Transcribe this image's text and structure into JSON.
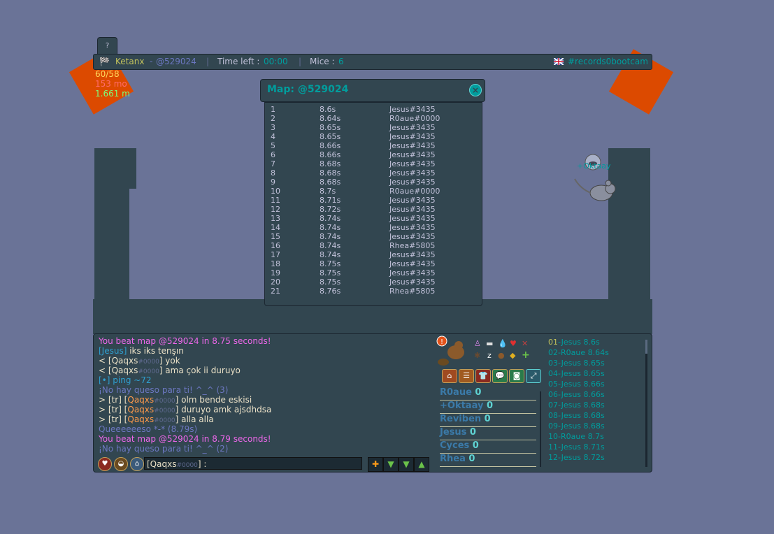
{
  "help_tab": "?",
  "top_bar": {
    "player": "Ketanx",
    "map_code": "@529024",
    "time_left_label": "Time left :",
    "time_left_value": "00:00",
    "mice_label": "Mice :",
    "mice_value": "6",
    "room": "#records0bootcam"
  },
  "stats": {
    "line1": "60/58",
    "line2": "153 mo",
    "line3": "1.661 m"
  },
  "mouse_label": "+Oktaay",
  "records_modal": {
    "title": "Map: @529024",
    "close": "×",
    "rows": [
      {
        "rank": "1",
        "time": "8.6s",
        "player": "Jesus#3435"
      },
      {
        "rank": "2",
        "time": "8.64s",
        "player": "R0aue#0000"
      },
      {
        "rank": "3",
        "time": "8.65s",
        "player": "Jesus#3435"
      },
      {
        "rank": "4",
        "time": "8.65s",
        "player": "Jesus#3435"
      },
      {
        "rank": "5",
        "time": "8.66s",
        "player": "Jesus#3435"
      },
      {
        "rank": "6",
        "time": "8.66s",
        "player": "Jesus#3435"
      },
      {
        "rank": "7",
        "time": "8.68s",
        "player": "Jesus#3435"
      },
      {
        "rank": "8",
        "time": "8.68s",
        "player": "Jesus#3435"
      },
      {
        "rank": "9",
        "time": "8.68s",
        "player": "Jesus#3435"
      },
      {
        "rank": "10",
        "time": "8.7s",
        "player": "R0aue#0000"
      },
      {
        "rank": "11",
        "time": "8.71s",
        "player": "Jesus#3435"
      },
      {
        "rank": "12",
        "time": "8.72s",
        "player": "Jesus#3435"
      },
      {
        "rank": "13",
        "time": "8.74s",
        "player": "Jesus#3435"
      },
      {
        "rank": "14",
        "time": "8.74s",
        "player": "Jesus#3435"
      },
      {
        "rank": "15",
        "time": "8.74s",
        "player": "Jesus#3435"
      },
      {
        "rank": "16",
        "time": "8.74s",
        "player": "Rhea#5805"
      },
      {
        "rank": "17",
        "time": "8.74s",
        "player": "Jesus#3435"
      },
      {
        "rank": "18",
        "time": "8.75s",
        "player": "Jesus#3435"
      },
      {
        "rank": "19",
        "time": "8.75s",
        "player": "Jesus#3435"
      },
      {
        "rank": "20",
        "time": "8.75s",
        "player": "Jesus#3435"
      },
      {
        "rank": "21",
        "time": "8.76s",
        "player": "Rhea#5805"
      }
    ]
  },
  "chat": [
    {
      "parts": [
        {
          "t": "You beat map @529024 in 8.75 seconds!",
          "c": "pink"
        }
      ]
    },
    {
      "parts": [
        {
          "t": "[Jesus]",
          "c": "teal"
        },
        {
          "t": " iks iks tenşın",
          "c": "cream"
        }
      ]
    },
    {
      "parts": [
        {
          "t": "< [",
          "c": "cream"
        },
        {
          "t": "Qaqxs",
          "c": "cream"
        },
        {
          "t": "#0000",
          "c": "small"
        },
        {
          "t": "] yok",
          "c": "cream"
        }
      ]
    },
    {
      "parts": [
        {
          "t": "< [",
          "c": "cream"
        },
        {
          "t": "Qaqxs",
          "c": "cream"
        },
        {
          "t": "#0000",
          "c": "small"
        },
        {
          "t": "] ama çok ii duruyo",
          "c": "cream"
        }
      ]
    },
    {
      "parts": [
        {
          "t": "[•] ping ~72",
          "c": "teal"
        }
      ]
    },
    {
      "parts": [
        {
          "t": "¡No hay queso para ti! ^_^ (3)",
          "c": "mid"
        }
      ]
    },
    {
      "parts": [
        {
          "t": "> [tr] [",
          "c": "cream"
        },
        {
          "t": "Qaqxs",
          "c": "orangename"
        },
        {
          "t": "#0000",
          "c": "small"
        },
        {
          "t": "] olm bende eskisi",
          "c": "cream"
        }
      ]
    },
    {
      "parts": [
        {
          "t": "> [tr] [",
          "c": "cream"
        },
        {
          "t": "Qaqxs",
          "c": "orangename"
        },
        {
          "t": "#0000",
          "c": "small"
        },
        {
          "t": "] duruyo amk ajsdhdsa",
          "c": "cream"
        }
      ]
    },
    {
      "parts": [
        {
          "t": "> [tr] [",
          "c": "cream"
        },
        {
          "t": "Qaqxs",
          "c": "orangename"
        },
        {
          "t": "#0000",
          "c": "small"
        },
        {
          "t": "] alla alla",
          "c": "cream"
        }
      ]
    },
    {
      "parts": [
        {
          "t": "Queeeeeeso *-* (8.79s)",
          "c": "mid"
        }
      ]
    },
    {
      "parts": [
        {
          "t": "You beat map @529024 in 8.79 seconds!",
          "c": "pink"
        }
      ]
    },
    {
      "parts": [
        {
          "t": "¡No hay queso para ti! ^_^ (2)",
          "c": "mid"
        }
      ]
    }
  ],
  "chat_input": {
    "prefix": "[Qaqxs",
    "tag": "#0000",
    "suffix": "] :"
  },
  "players": [
    {
      "name": "R0aue",
      "score": "0"
    },
    {
      "name": "+Oktaay",
      "score": "0"
    },
    {
      "name": "Reviben",
      "score": "0"
    },
    {
      "name": "Jesus",
      "score": "0"
    },
    {
      "name": "Cyces",
      "score": "0"
    },
    {
      "name": "Rhea",
      "score": "0"
    }
  ],
  "leaderboard": [
    {
      "num": "01",
      "rest": "-Jesus 8.6s"
    },
    {
      "num": "02",
      "rest": "-R0aue 8.64s"
    },
    {
      "num": "03",
      "rest": "-Jesus 8.65s"
    },
    {
      "num": "04",
      "rest": "-Jesus 8.65s"
    },
    {
      "num": "05",
      "rest": "-Jesus 8.66s"
    },
    {
      "num": "06",
      "rest": "-Jesus 8.66s"
    },
    {
      "num": "07",
      "rest": "-Jesus 8.68s"
    },
    {
      "num": "08",
      "rest": "-Jesus 8.68s"
    },
    {
      "num": "09",
      "rest": "-Jesus 8.68s"
    },
    {
      "num": "10",
      "rest": "-R0aue 8.7s"
    },
    {
      "num": "11",
      "rest": "-Jesus 8.71s"
    },
    {
      "num": "12",
      "rest": "-Jesus 8.72s"
    }
  ],
  "colors": {
    "panel": "#324650",
    "lava": "#dc4a00",
    "background": "#6a7397",
    "accent": "#009d9d",
    "pink": "#ed67ea"
  }
}
